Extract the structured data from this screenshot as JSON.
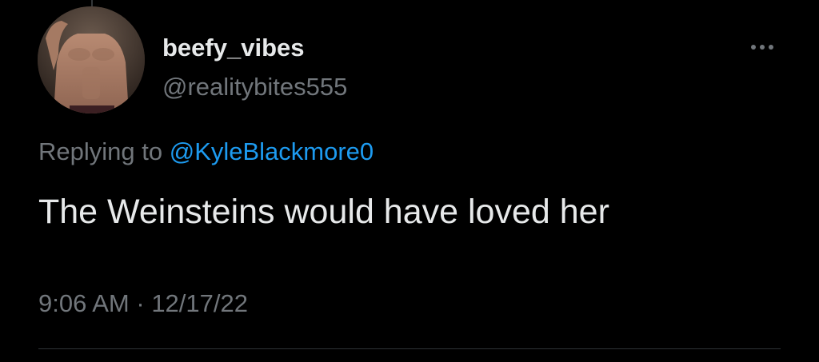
{
  "tweet": {
    "author": {
      "display_name": "beefy_vibes",
      "handle": "@realitybites555",
      "avatar_icon": "profile-photo"
    },
    "more_icon": "more-horizontal-icon",
    "reply_context": {
      "prefix": "Replying to ",
      "mention": "@KyleBlackmore0"
    },
    "text": "The Weinsteins would have loved her",
    "time": "9:06 AM",
    "separator": " · ",
    "date": "12/17/22"
  },
  "colors": {
    "background": "#000000",
    "primary_text": "#e7e9ea",
    "secondary_text": "#71767b",
    "link": "#1d9bf0",
    "divider": "#2f3336"
  }
}
